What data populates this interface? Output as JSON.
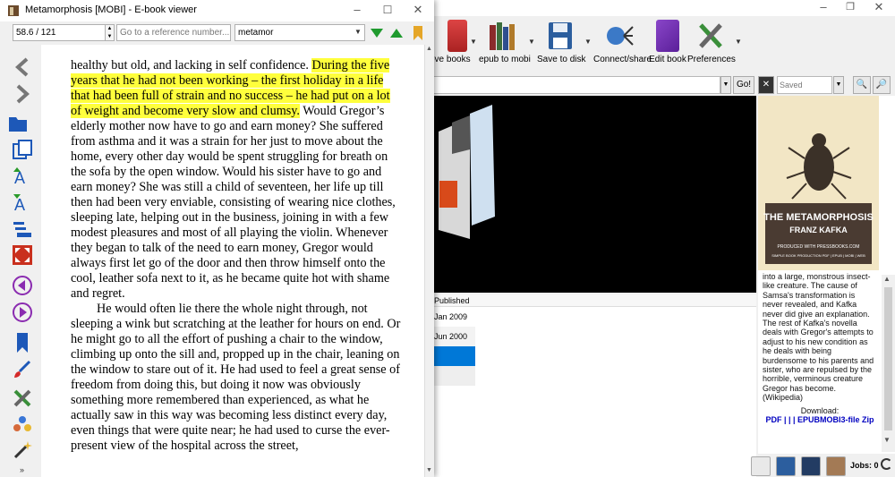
{
  "viewer": {
    "title": "Metamorphosis [MOBI] - E-book viewer",
    "position": "58.6 / 121",
    "reference_placeholder": "Go to a reference number...",
    "search_value": "metamor",
    "text": {
      "p1_before": "healthy but old, and lacking in self confidence. ",
      "p1_highlight": "During the five years that he had not been working – the first holiday in a life that had been full of strain and no success – he had put on a lot of weight and become very slow and clumsy.",
      "p1_after": " Would Gregor’s elderly mother now have to go and earn money? She suffered from asthma and it was a strain for her just to move about the home, every other day would be spent struggling for breath on the sofa by the open window. Would his sister have to go and earn money? She was still a child of seventeen, her life up till then had been very enviable, consisting of wearing nice clothes, sleeping late, helping out in the business, joining in with a few modest pleasures and most of all playing the violin. Whenever they began to talk of the need to earn money, Gregor would always first let go of the door and then throw himself onto the cool, leather sofa next to it, as he became quite hot with shame and regret.",
      "p2": "He would often lie there the whole night through, not sleeping a wink but scratching at the leather for hours on end. Or he might go to all the effort of pushing a chair to the window, climbing up onto the sill and, propped up in the chair, leaning on the window to stare out of it. He had used to feel a great sense of freedom from doing this, but doing it now was obviously something more remembered than experienced, as what he actually saw in this way was becoming less distinct every day, even things that were quite near; he had used to curse the ever-present view of the hospital across the street,"
    }
  },
  "main": {
    "toolbar": {
      "remove_books": "ove books",
      "epub_to_mobi": "epub to mobi",
      "save_to_disk": "Save to disk",
      "connect_share": "Connect/share",
      "edit_book": "Edit book",
      "preferences": "Preferences"
    },
    "search": {
      "go_label": "Go!",
      "saved_searches_placeholder": "Saved Searches"
    },
    "table": {
      "published_header": "Published",
      "rows": [
        "Jan 2009",
        "Jun 2000",
        "",
        ""
      ]
    },
    "cover": {
      "title": "THE METAMORPHOSIS",
      "author": "FRANZ KAFKA",
      "produced_by": "PRODUCED WITH PRESSBOOKS.COM",
      "formats": "SIMPLE BOOK PRODUCTION PDF | EPUB | MOBI | WEB"
    },
    "details": {
      "description": "into a large, monstrous insect-like creature. The cause of Samsa's transformation is never revealed, and Kafka never did give an explanation. The rest of Kafka's novella deals with Gregor's attempts to adjust to his new condition as he deals with being burdensome to his parents and sister, who are repulsed by the horrible, verminous creature Gregor has become. (Wikipedia)",
      "download_label": "Download:",
      "download_links": "PDF | | | EPUBMOBI3-file Zip"
    },
    "status": {
      "jobs": "Jobs: 0"
    }
  },
  "colors": {
    "highlight": "#ffff3c",
    "selection": "#0078d7",
    "link_blue": "#0000c0",
    "cover_banner": "#4a3b32"
  }
}
